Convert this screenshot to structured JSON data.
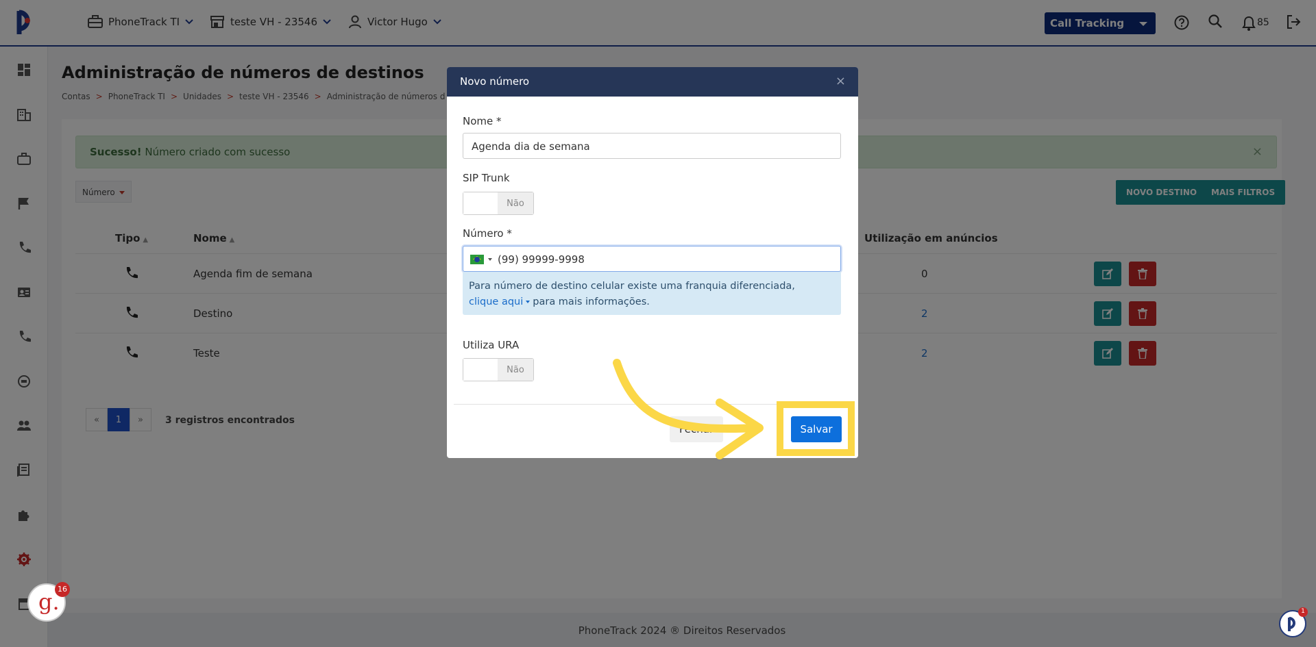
{
  "header": {
    "account": "PhoneTrack TI",
    "unit": "teste VH - 23546",
    "user": "Victor Hugo",
    "product_select": "Call Tracking",
    "notifications_count": "85"
  },
  "page": {
    "title": "Administração de números de destinos",
    "breadcrumb": [
      "Contas",
      "PhoneTrack TI",
      "Unidades",
      "teste VH - 23546",
      "Administração de números de destinos"
    ]
  },
  "alert": {
    "strong": "Sucesso!",
    "text": "Número criado com sucesso"
  },
  "filter": {
    "label": "Número"
  },
  "buttons": {
    "new_destination": "NOVO DESTINO",
    "more_filters": "MAIS FILTROS"
  },
  "table": {
    "headers": {
      "tipo": "Tipo",
      "nome": "Nome",
      "utilizacao": "Utilização em anúncios"
    },
    "rows": [
      {
        "nome": "Agenda fim de semana",
        "uso": "0"
      },
      {
        "nome": "Destino",
        "uso": "2"
      },
      {
        "nome": "Teste",
        "uso": "2"
      }
    ]
  },
  "pagination": {
    "prev": "«",
    "current": "1",
    "next": "»",
    "info": "3 registros encontrados"
  },
  "footer": "PhoneTrack 2024 ® Direitos Reservados",
  "modal": {
    "title": "Novo número",
    "close": "×",
    "nome_label": "Nome *",
    "nome_value": "Agenda dia de semana",
    "sip_label": "SIP Trunk",
    "sip_value": "Não",
    "numero_label": "Número *",
    "numero_value": "(99) 99999-9998",
    "info_text": "Para número de destino celular existe uma franquia diferenciada,",
    "info_link": "clique aqui",
    "info_tail": "para mais informações.",
    "ura_label": "Utiliza URA",
    "ura_value": "Não",
    "fechar": "Fechar",
    "salvar": "Salvar"
  },
  "badges": {
    "g_count": "16",
    "help_count": "1",
    "g_letter": "g."
  },
  "colors": {
    "primary": "#0d2a7a",
    "teal": "#1b8f92",
    "danger": "#c62828",
    "highlight": "#fbd747",
    "save": "#0d6fdc"
  }
}
